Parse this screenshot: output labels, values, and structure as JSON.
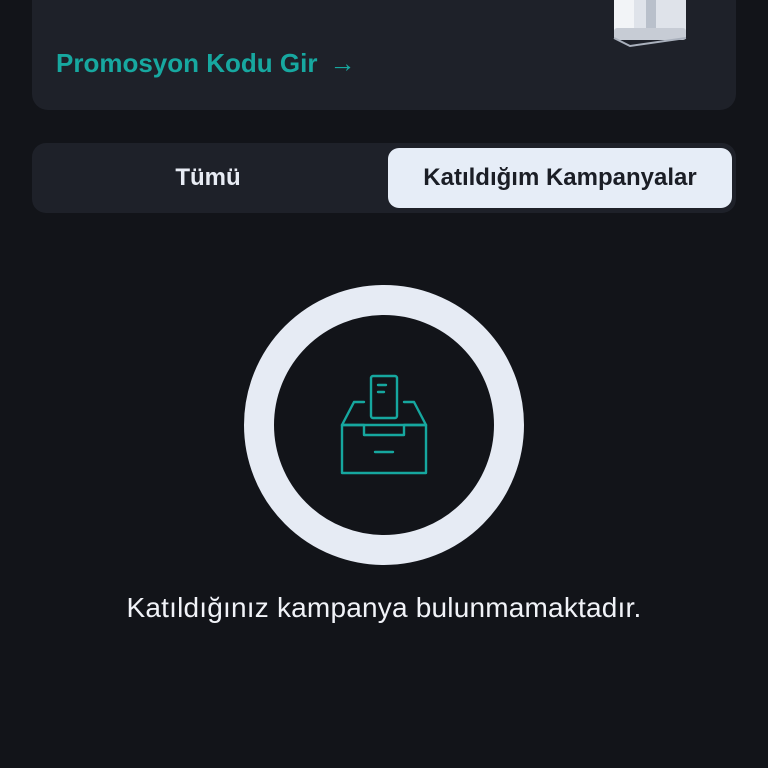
{
  "promo_card": {
    "link_label": "Promosyon Kodu Gir",
    "link_arrow": "→",
    "gift_icon": "gift-box-icon"
  },
  "tabs": {
    "all_label": "Tümü",
    "joined_label": "Katıldığım Kampanyalar",
    "selected": "joined"
  },
  "empty_state": {
    "icon": "inbox-tray-icon",
    "message": "Katıldığınız kampanya bulunmamaktadır."
  },
  "colors": {
    "background": "#121419",
    "card": "#1e2129",
    "accent": "#17a8a0",
    "selected_tab": "#e6edf7"
  }
}
